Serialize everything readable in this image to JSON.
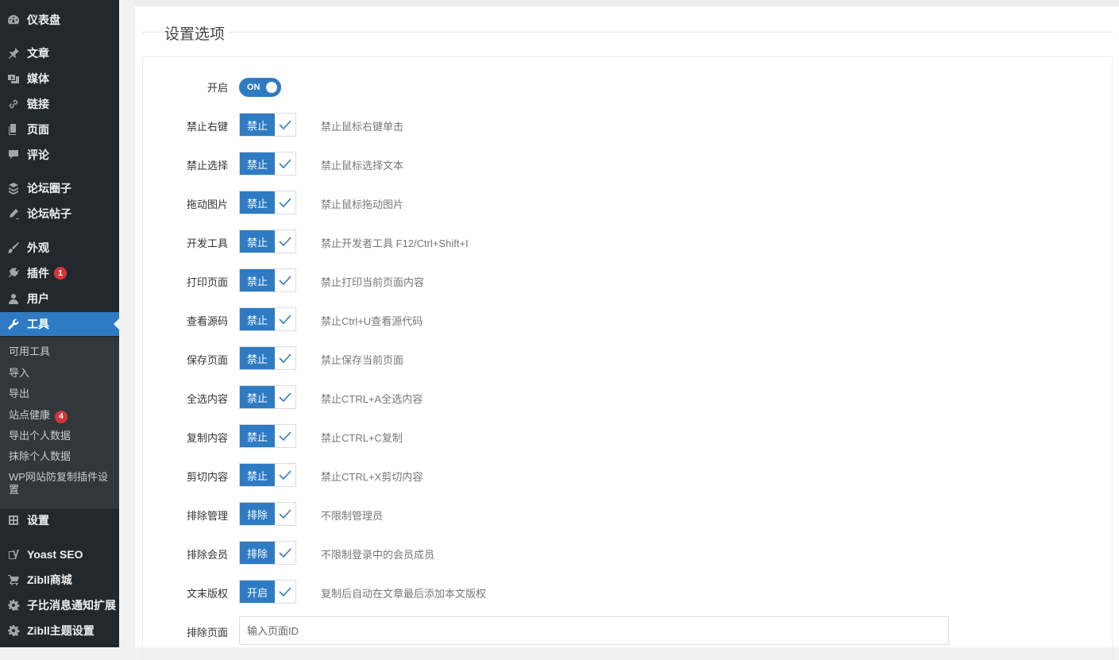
{
  "sidebar": {
    "items": [
      {
        "label": "仪表盘",
        "icon": "dashboard-icon"
      },
      {
        "label": "文章",
        "icon": "pin-icon"
      },
      {
        "label": "媒体",
        "icon": "media-icon"
      },
      {
        "label": "链接",
        "icon": "link-icon"
      },
      {
        "label": "页面",
        "icon": "page-icon"
      },
      {
        "label": "评论",
        "icon": "comment-icon"
      },
      {
        "label": "论坛圈子",
        "icon": "forum-circle-icon"
      },
      {
        "label": "论坛帖子",
        "icon": "forum-post-icon"
      },
      {
        "label": "外观",
        "icon": "brush-icon"
      },
      {
        "label": "插件",
        "icon": "plugin-icon",
        "badge": "1"
      },
      {
        "label": "用户",
        "icon": "user-icon"
      },
      {
        "label": "工具",
        "icon": "wrench-icon",
        "active": true
      },
      {
        "label": "设置",
        "icon": "settings-icon"
      },
      {
        "label": "Yoast SEO",
        "icon": "yoast-icon"
      },
      {
        "label": "Zibll商城",
        "icon": "cart-icon"
      },
      {
        "label": "子比消息通知扩展",
        "icon": "gear-icon"
      },
      {
        "label": "Zibll主题设置",
        "icon": "gear-icon"
      }
    ],
    "submenu": [
      {
        "label": "可用工具"
      },
      {
        "label": "导入"
      },
      {
        "label": "导出"
      },
      {
        "label": "站点健康",
        "badge": "4"
      },
      {
        "label": "导出个人数据"
      },
      {
        "label": "抹除个人数据"
      },
      {
        "label": "WP网站防复制插件设置"
      }
    ]
  },
  "main": {
    "section_title": "设置选项",
    "enable": {
      "label": "开启",
      "switch_text": "ON",
      "on": true
    },
    "rows": [
      {
        "label": "禁止右键",
        "tag": "禁止",
        "checked": true,
        "desc": "禁止鼠标右键单击"
      },
      {
        "label": "禁止选择",
        "tag": "禁止",
        "checked": true,
        "desc": "禁止鼠标选择文本"
      },
      {
        "label": "拖动图片",
        "tag": "禁止",
        "checked": true,
        "desc": "禁止鼠标拖动图片"
      },
      {
        "label": "开发工具",
        "tag": "禁止",
        "checked": true,
        "desc": "禁止开发者工具 F12/Ctrl+Shift+I"
      },
      {
        "label": "打印页面",
        "tag": "禁止",
        "checked": true,
        "desc": "禁止打印当前页面内容"
      },
      {
        "label": "查看源码",
        "tag": "禁止",
        "checked": true,
        "desc": "禁止Ctrl+U查看源代码"
      },
      {
        "label": "保存页面",
        "tag": "禁止",
        "checked": true,
        "desc": "禁止保存当前页面"
      },
      {
        "label": "全选内容",
        "tag": "禁止",
        "checked": true,
        "desc": "禁止CTRL+A全选内容"
      },
      {
        "label": "复制内容",
        "tag": "禁止",
        "checked": true,
        "desc": "禁止CTRL+C复制"
      },
      {
        "label": "剪切内容",
        "tag": "禁止",
        "checked": true,
        "desc": "禁止CTRL+X剪切内容"
      },
      {
        "label": "排除管理",
        "tag": "排除",
        "checked": true,
        "desc": "不限制管理员"
      },
      {
        "label": "排除会员",
        "tag": "排除",
        "checked": true,
        "desc": "不限制登录中的会员成员"
      },
      {
        "label": "文末版权",
        "tag": "开启",
        "checked": true,
        "desc": "复制后自动在文章最后添加本文版权"
      }
    ],
    "exclude_page": {
      "label": "排除页面",
      "placeholder": "输入页面ID",
      "value": ""
    }
  },
  "colors": {
    "sidebar_bg": "#23282d",
    "submenu_bg": "#32373c",
    "accent": "#2e7bc4",
    "badge": "#d63638"
  }
}
